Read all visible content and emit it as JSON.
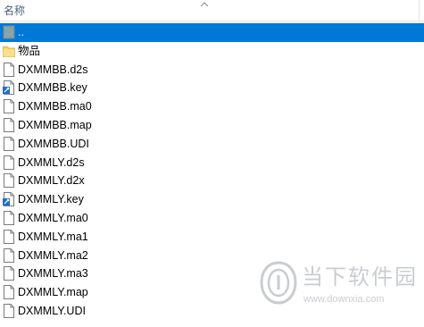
{
  "header": {
    "name_label": "名称"
  },
  "files": [
    {
      "name": "..",
      "icon": "parent-folder-icon",
      "selected": true
    },
    {
      "name": "物品",
      "icon": "folder-icon"
    },
    {
      "name": "DXMMBB.d2s",
      "icon": "file-icon"
    },
    {
      "name": "DXMMBB.key",
      "icon": "key-file-icon"
    },
    {
      "name": "DXMMBB.ma0",
      "icon": "file-icon"
    },
    {
      "name": "DXMMBB.map",
      "icon": "file-icon"
    },
    {
      "name": "DXMMBB.UDI",
      "icon": "file-icon"
    },
    {
      "name": "DXMMLY.d2s",
      "icon": "file-icon"
    },
    {
      "name": "DXMMLY.d2x",
      "icon": "file-icon"
    },
    {
      "name": "DXMMLY.key",
      "icon": "key-file-icon"
    },
    {
      "name": "DXMMLY.ma0",
      "icon": "file-icon"
    },
    {
      "name": "DXMMLY.ma1",
      "icon": "file-icon"
    },
    {
      "name": "DXMMLY.ma2",
      "icon": "file-icon"
    },
    {
      "name": "DXMMLY.ma3",
      "icon": "file-icon"
    },
    {
      "name": "DXMMLY.map",
      "icon": "file-icon"
    },
    {
      "name": "DXMMLY.UDI",
      "icon": "file-icon"
    }
  ],
  "watermark": {
    "brand": "当下软件园",
    "url": "www.downxia.com"
  },
  "colors": {
    "selection": "#0078d7",
    "folder": "#f8d775",
    "header_text": "#4c607a",
    "watermark": "#c4c8cc"
  }
}
